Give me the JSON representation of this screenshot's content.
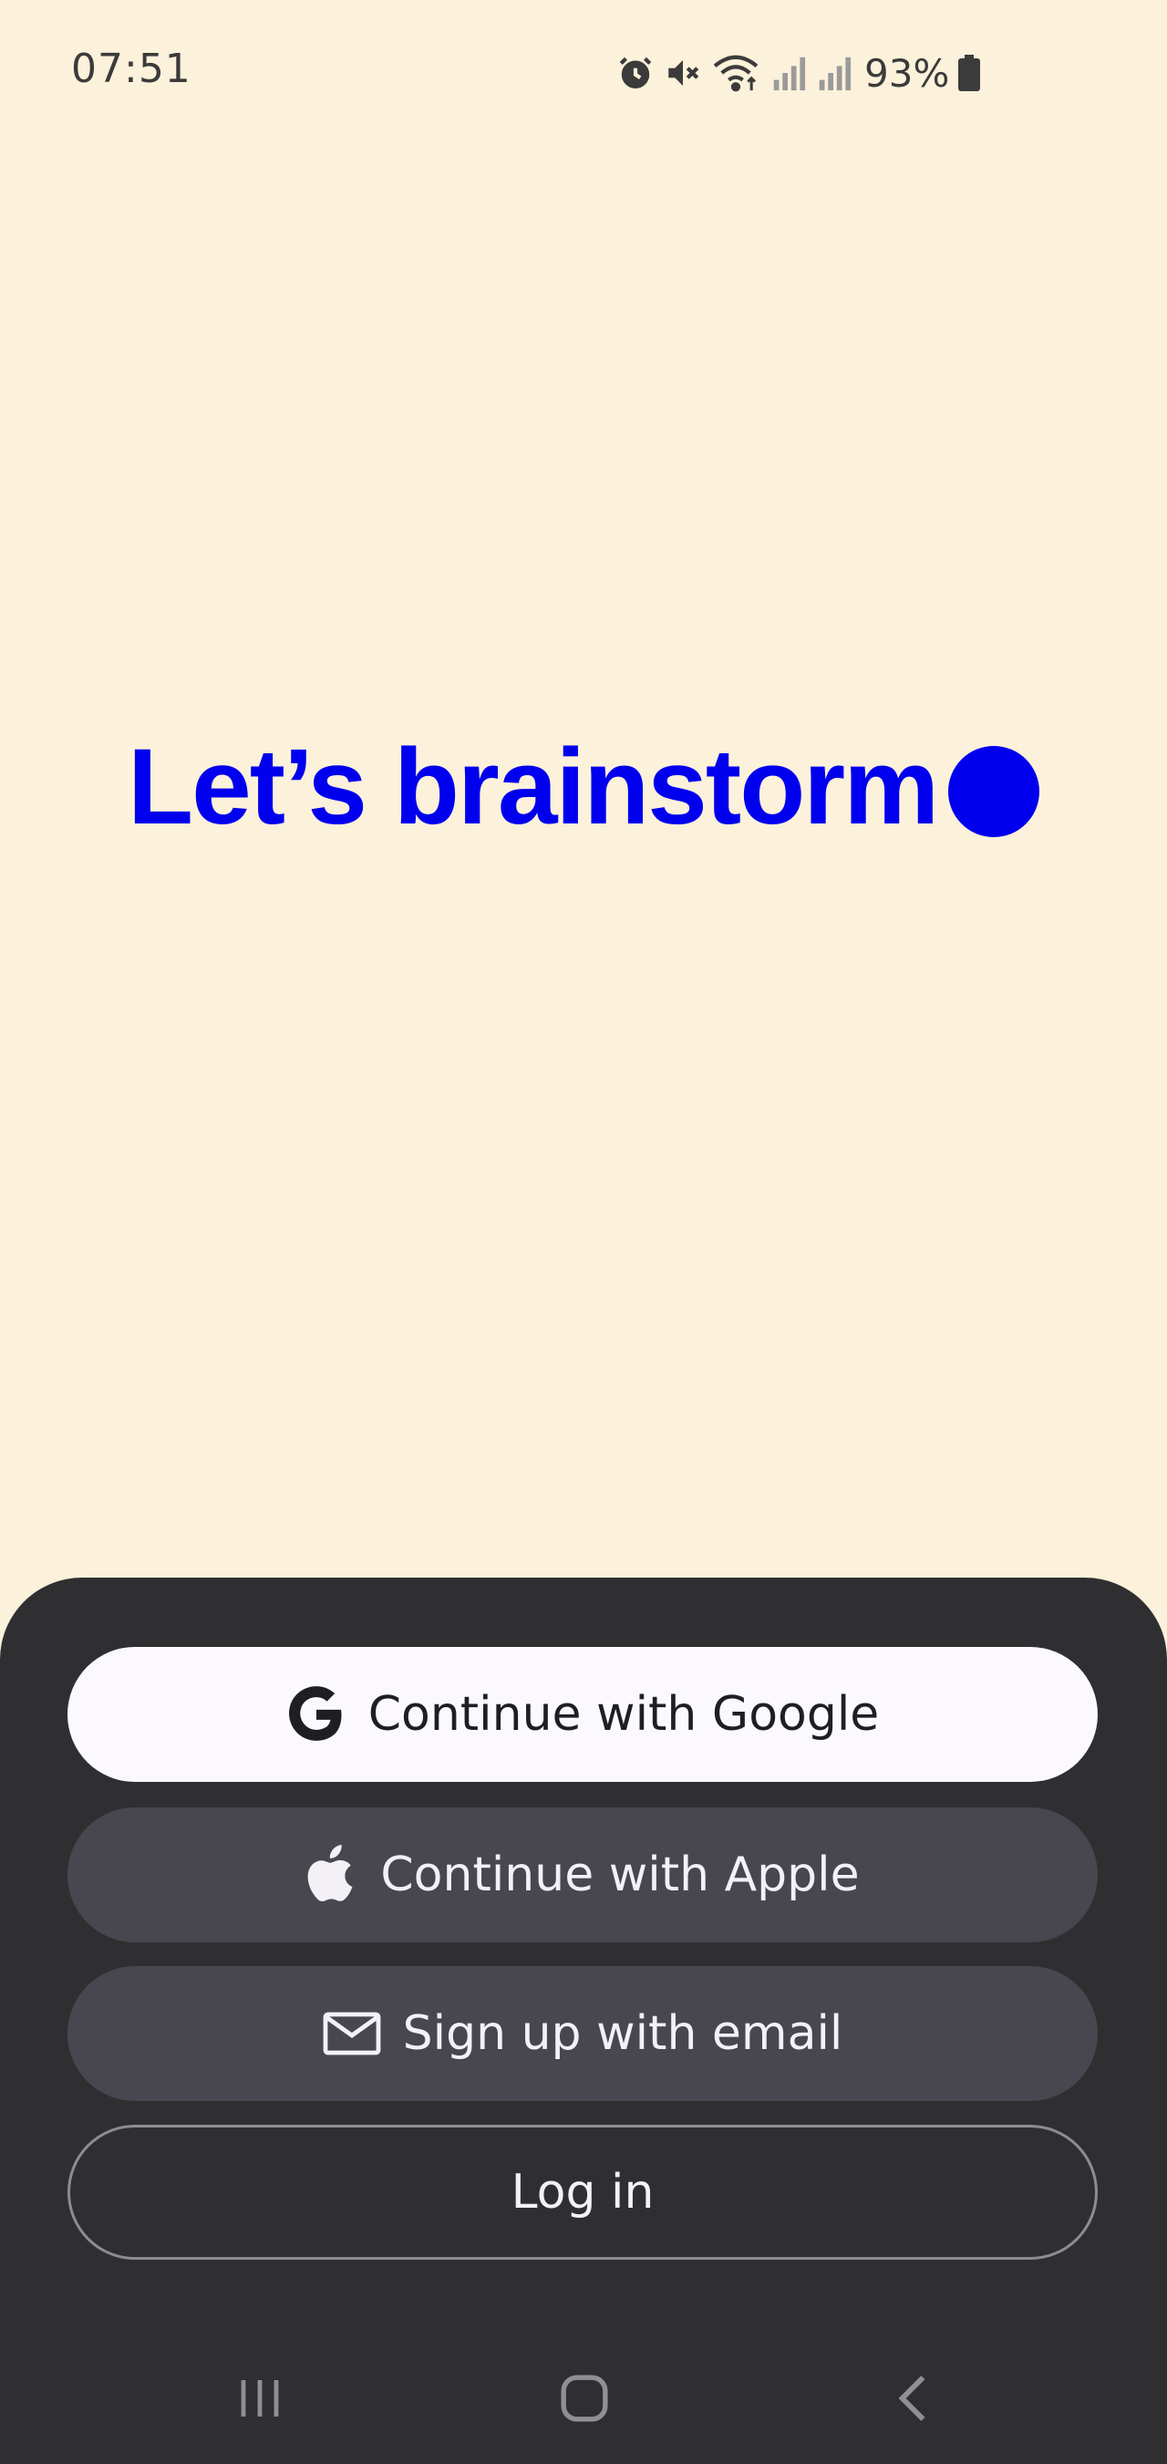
{
  "status_bar": {
    "time": "07:51",
    "battery": "93%",
    "icons": [
      "alarm-icon",
      "mute-icon",
      "wifi-icon",
      "signal-icon",
      "signal-icon",
      "battery-icon"
    ]
  },
  "hero": {
    "headline": "Let’s brainstorm",
    "accent_color": "#0000ee"
  },
  "auth": {
    "google_label": "Continue with Google",
    "apple_label": "Continue with Apple",
    "email_label": "Sign up with email",
    "login_label": "Log in"
  },
  "nav": {
    "items": [
      "recent-apps-icon",
      "home-icon",
      "back-icon"
    ]
  },
  "colors": {
    "background": "#fcf1da",
    "sheet": "#2f2f32",
    "button_light": "#fbf9fd",
    "button_dark": "#48464f"
  }
}
